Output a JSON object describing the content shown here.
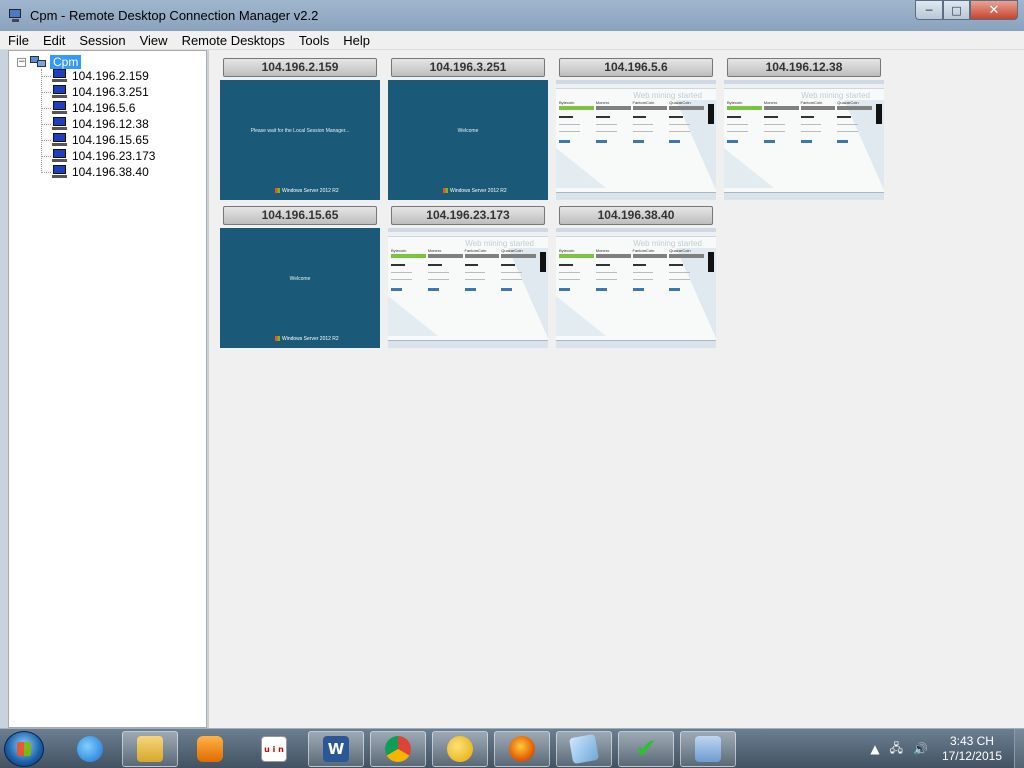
{
  "window": {
    "title": "Cpm - Remote Desktop Connection Manager v2.2",
    "controls": {
      "minimize": "─",
      "maximize": "□",
      "close": "✕"
    }
  },
  "menu": [
    "File",
    "Edit",
    "Session",
    "View",
    "Remote Desktops",
    "Tools",
    "Help"
  ],
  "tree": {
    "expander": "−",
    "root": "Cpm",
    "nodes": [
      "104.196.2.159",
      "104.196.3.251",
      "104.196.5.6",
      "104.196.12.38",
      "104.196.15.65",
      "104.196.23.173",
      "104.196.38.40"
    ]
  },
  "thumbnails": [
    {
      "label": "104.196.2.159",
      "state": "login",
      "message": "Please wait for the Local Session Manager..."
    },
    {
      "label": "104.196.3.251",
      "state": "login",
      "message": "Welcome"
    },
    {
      "label": "104.196.5.6",
      "state": "web"
    },
    {
      "label": "104.196.12.38",
      "state": "web"
    },
    {
      "label": "104.196.15.65",
      "state": "login",
      "message": "Welcome"
    },
    {
      "label": "104.196.23.173",
      "state": "web"
    },
    {
      "label": "104.196.38.40",
      "state": "web"
    }
  ],
  "remote_screen": {
    "logo_text": "Windows Server 2012 R2",
    "page_title": "Web mining started",
    "coins": [
      "Bytecoin",
      "Monero",
      "FantomCoin",
      "QuazarCoin"
    ]
  },
  "taskbar": {
    "apps": [
      {
        "name": "internet-explorer",
        "glyph": ""
      },
      {
        "name": "windows-explorer",
        "glyph": ""
      },
      {
        "name": "media-player",
        "glyph": ""
      },
      {
        "name": "unikey",
        "glyph": "u i n"
      },
      {
        "name": "word",
        "glyph": "W"
      },
      {
        "name": "chrome",
        "glyph": ""
      },
      {
        "name": "chat-app",
        "glyph": ""
      },
      {
        "name": "firefox",
        "glyph": ""
      },
      {
        "name": "notes",
        "glyph": ""
      },
      {
        "name": "check-app",
        "glyph": "✔"
      },
      {
        "name": "rdcman",
        "glyph": ""
      }
    ],
    "time": "3:43 CH",
    "date": "17/12/2015"
  }
}
